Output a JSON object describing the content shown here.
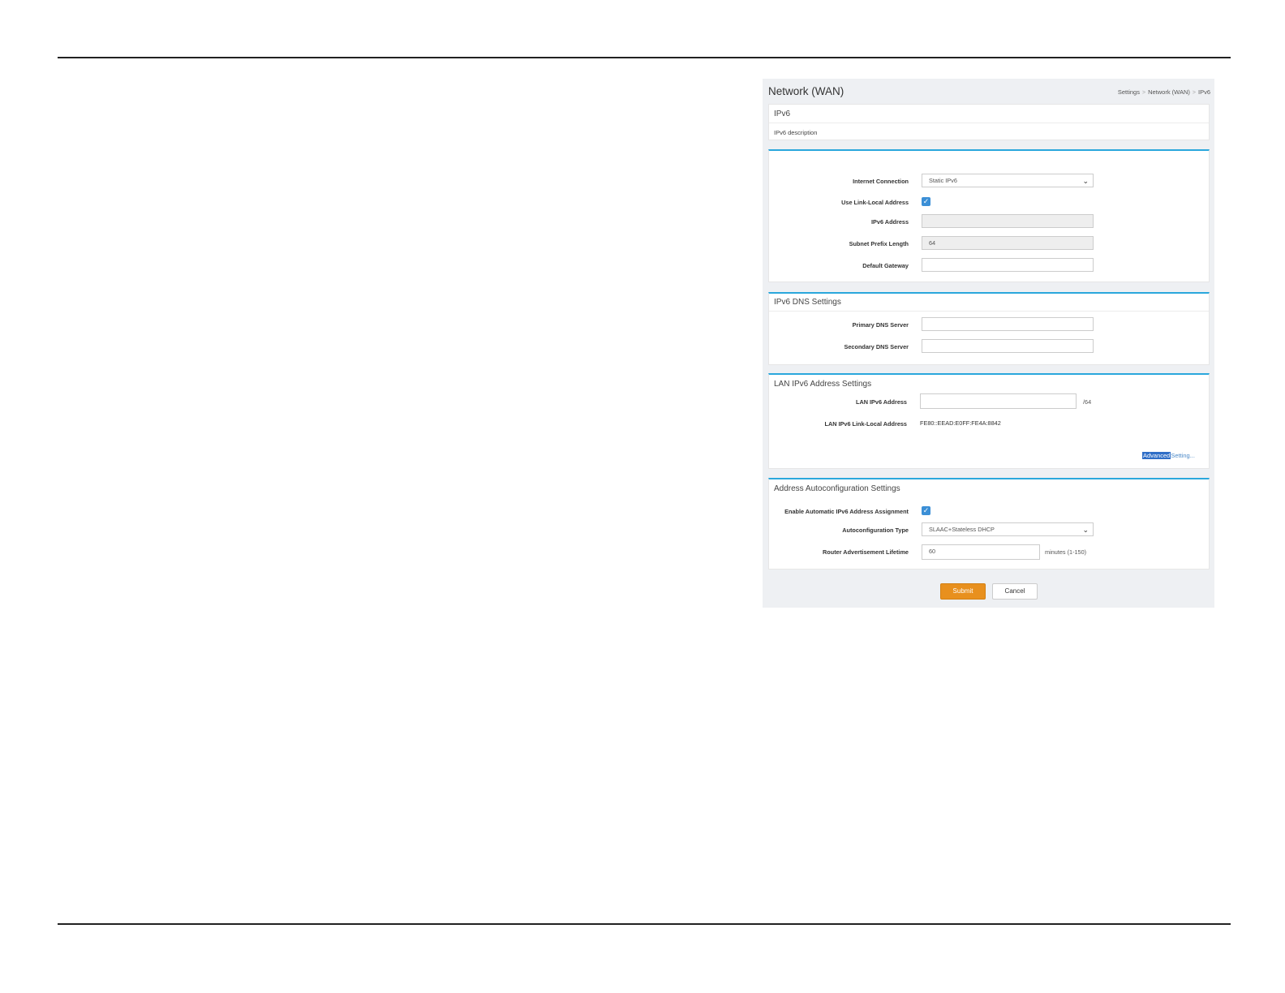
{
  "header": {
    "title": "Network (WAN)",
    "breadcrumbs": [
      "Settings",
      "Network (WAN)",
      "IPv6"
    ],
    "separator": ">"
  },
  "intro": {
    "heading": "IPv6",
    "description": "IPv6 description"
  },
  "connection": {
    "internet_connection_label": "Internet Connection",
    "internet_connection_value": "Static IPv6",
    "link_local_label": "Use Link-Local Address",
    "link_local_checked": true,
    "ipv6_address_label": "IPv6 Address",
    "ipv6_address_value": "",
    "prefix_length_label": "Subnet Prefix Length",
    "prefix_length_value": "64",
    "gateway_label": "Default Gateway",
    "gateway_value": ""
  },
  "dns": {
    "heading": "IPv6 DNS Settings",
    "primary_label": "Primary DNS Server",
    "primary_value": "",
    "secondary_label": "Secondary DNS Server",
    "secondary_value": ""
  },
  "lan": {
    "heading": "LAN IPv6 Address Settings",
    "address_label": "LAN IPv6 Address",
    "address_value": "",
    "address_suffix": "/64",
    "link_local_label": "LAN IPv6 Link-Local Address",
    "link_local_value": "FE80::EEAD:E0FF:FE4A:8842",
    "advanced_highlight": "Advanced",
    "advanced_rest": "Setting..."
  },
  "autoconf": {
    "heading": "Address Autoconfiguration Settings",
    "enable_label": "Enable Automatic IPv6 Address Assignment",
    "enable_checked": true,
    "type_label": "Autoconfiguration Type",
    "type_value": "SLAAC+Stateless DHCP",
    "lifetime_label": "Router Advertisement Lifetime",
    "lifetime_value": "60",
    "lifetime_hint": "minutes (1-150)"
  },
  "actions": {
    "submit_label": "Submit",
    "cancel_label": "Cancel"
  },
  "colors": {
    "accent": "#2aa7dc",
    "submit": "#e8901e",
    "checkbox": "#3b8fd6"
  }
}
